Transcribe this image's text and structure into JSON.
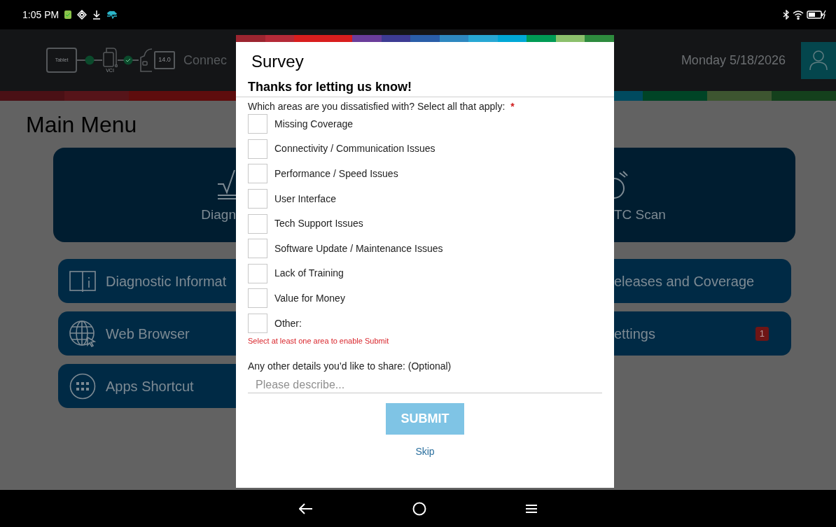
{
  "status_bar": {
    "time": "1:05 PM"
  },
  "header": {
    "tablet_label": "Tablet",
    "vci_label": "VCI",
    "voltage": "14.0",
    "connection_text": "Connec",
    "date": "Monday 5/18/2026"
  },
  "main_menu": {
    "title": "Main Menu",
    "primary_tiles": [
      {
        "kind": "diagnostics",
        "label": "Diagn"
      },
      {
        "kind": "scan",
        "label": "TC Scan"
      }
    ],
    "rows": [
      {
        "left": {
          "kind": "info",
          "label": "Diagnostic Informat"
        },
        "right": {
          "label": "eleases and Coverage"
        }
      },
      {
        "left": {
          "kind": "globe",
          "label": "Web Browser"
        },
        "right": {
          "label": "ettings",
          "badge": "1"
        }
      },
      {
        "left": {
          "kind": "apps",
          "label": "Apps Shortcut"
        }
      }
    ]
  },
  "survey": {
    "title": "Survey",
    "heading": "Thanks for letting us know!",
    "question": "Which areas are you dissatisfied with? Select all that apply:",
    "required_mark": "*",
    "options": [
      {
        "label": "Missing Coverage",
        "checked": false
      },
      {
        "label": "Connectivity / Communication Issues",
        "checked": false
      },
      {
        "label": "Performance / Speed Issues",
        "checked": false
      },
      {
        "label": "User Interface",
        "checked": false
      },
      {
        "label": "Tech Support Issues",
        "checked": false
      },
      {
        "label": "Software Update / Maintenance Issues",
        "checked": false
      },
      {
        "label": "Lack of Training",
        "checked": false
      },
      {
        "label": "Value for Money",
        "checked": false
      },
      {
        "label": "Other:",
        "checked": false
      }
    ],
    "validation_message": "Select at least one area to enable Submit",
    "details_label": "Any other details you’d like to share: (Optional)",
    "details_placeholder": "Please describe...",
    "submit": {
      "label": "SUBMIT",
      "disabled": true
    },
    "skip": "Skip"
  }
}
